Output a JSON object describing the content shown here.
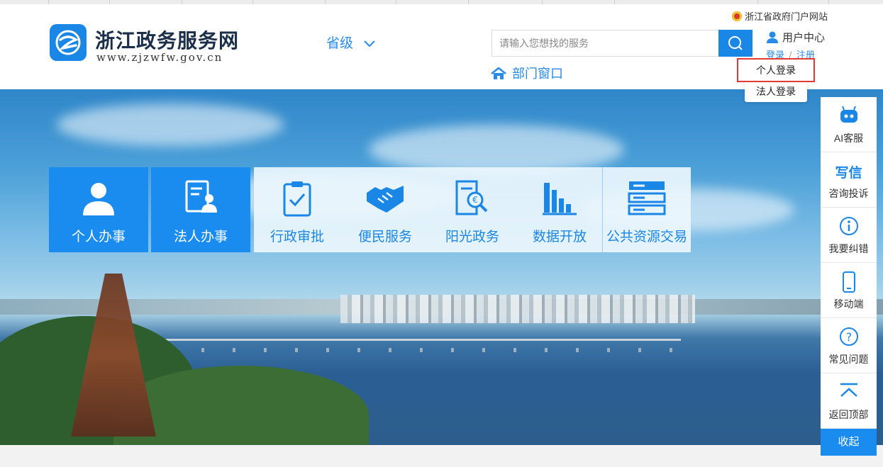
{
  "header": {
    "site_title": "浙江政务服务网",
    "site_url": "www.zjzwfw.gov.cn",
    "province_selector": "省级",
    "search_placeholder": "请输入您想找的服务",
    "dept_window": "部门窗口",
    "gov_portal_link": "浙江省政府门户网站",
    "user_center": "用户中心",
    "login": "登录",
    "separator": "/",
    "register": "注册",
    "login_menu": [
      "个人登录",
      "法人登录"
    ]
  },
  "tiles": [
    {
      "label": "个人办事",
      "icon": "person-icon"
    },
    {
      "label": "法人办事",
      "icon": "corporate-icon"
    },
    {
      "label": "行政审批",
      "icon": "clipboard-check-icon"
    },
    {
      "label": "便民服务",
      "icon": "handshake-icon"
    },
    {
      "label": "阳光政务",
      "icon": "document-search-icon"
    },
    {
      "label": "数据开放",
      "icon": "bar-chart-icon"
    },
    {
      "label": "公共资源交易",
      "icon": "server-icon"
    }
  ],
  "side_toolbar": {
    "items": [
      {
        "label": "AI客服",
        "icon": "robot-icon"
      },
      {
        "label": "咨询投诉",
        "icon": "write-icon",
        "icon_text": "写信"
      },
      {
        "label": "我要纠错",
        "icon": "info-icon"
      },
      {
        "label": "移动端",
        "icon": "mobile-icon"
      },
      {
        "label": "常见问题",
        "icon": "question-icon"
      },
      {
        "label": "返回顶部",
        "icon": "back-to-top-icon"
      }
    ],
    "collapse": "收起"
  },
  "colors": {
    "brand_blue": "#1a86e6",
    "tile_blue": "#1a8cf0",
    "highlight_red": "#e53935"
  }
}
